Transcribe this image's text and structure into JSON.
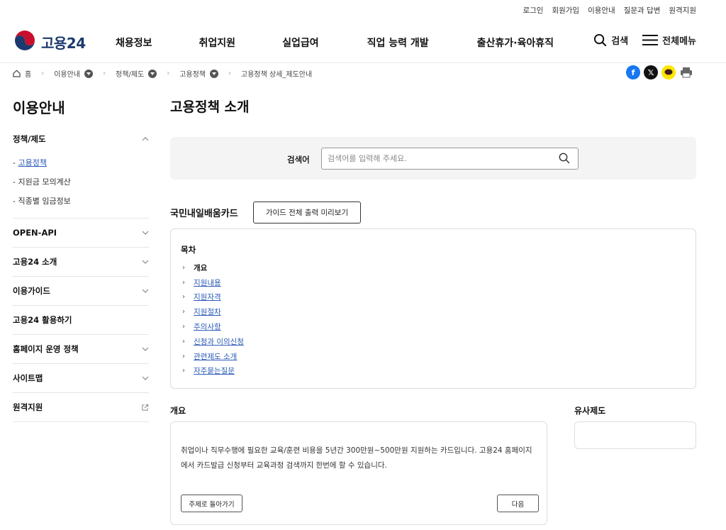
{
  "utility_links": [
    "로그인",
    "회원가입",
    "이용안내",
    "질문과 답변",
    "원격지원"
  ],
  "logo": {
    "text": "고용24"
  },
  "gnb": [
    "채용정보",
    "취업지원",
    "실업급여",
    "직업 능력 개발",
    "출산휴가·육아휴직"
  ],
  "header_actions": {
    "search": "검색",
    "menu": "전체메뉴"
  },
  "breadcrumb": {
    "home": "홈",
    "items": [
      "이용안내",
      "정책/제도",
      "고용정책"
    ],
    "current": "고용정책 상세_제도안내"
  },
  "share_icons": [
    "facebook-icon",
    "x-icon",
    "kakaotalk-icon",
    "print-icon"
  ],
  "sidebar": {
    "title": "이용안내",
    "groups": [
      {
        "label": "정책/제도",
        "expanded": true,
        "sub": [
          "고용정책",
          "지원금 모의계산",
          "직종별 임금정보"
        ]
      },
      {
        "label": "OPEN-API"
      },
      {
        "label": "고용24 소개"
      },
      {
        "label": "이용가이드"
      },
      {
        "label": "고용24 활용하기"
      },
      {
        "label": "홈페이지 운영 정책"
      },
      {
        "label": "사이트맵"
      },
      {
        "label": "원격지원"
      }
    ],
    "active_sub": "고용정책"
  },
  "main": {
    "title": "고용정책 소개",
    "search": {
      "label": "검색어",
      "placeholder": "검색어를 입력해 주세요."
    },
    "card_title": "국민내일배움카드",
    "guide_button": "가이드 전체 출력 미리보기",
    "toc": {
      "title": "목차",
      "items": [
        "개요",
        "지원내용",
        "지원자격",
        "지원절차",
        "주의사항",
        "신청과 이의신청",
        "관련제도 소개",
        "자주묻는질문"
      ]
    },
    "overview": {
      "title": "개요",
      "text": "취업이나 직무수행에 필요한 교육/훈련 비용을 5년간 300만원~500만원 지원하는 카드입니다. 고용24 홈페이지에서 카드발급 신청부터 교육과정 검색까지 한번에 할 수 있습니다.",
      "back_button": "주제로 돌아가기",
      "next_button": "다음"
    },
    "similar": {
      "title": "유사제도"
    }
  },
  "colors": {
    "brand_navy": "#1c3a6e",
    "link_blue": "#2b5bb8",
    "facebook": "#1877f2",
    "x": "#111111",
    "kakao": "#fee500"
  }
}
